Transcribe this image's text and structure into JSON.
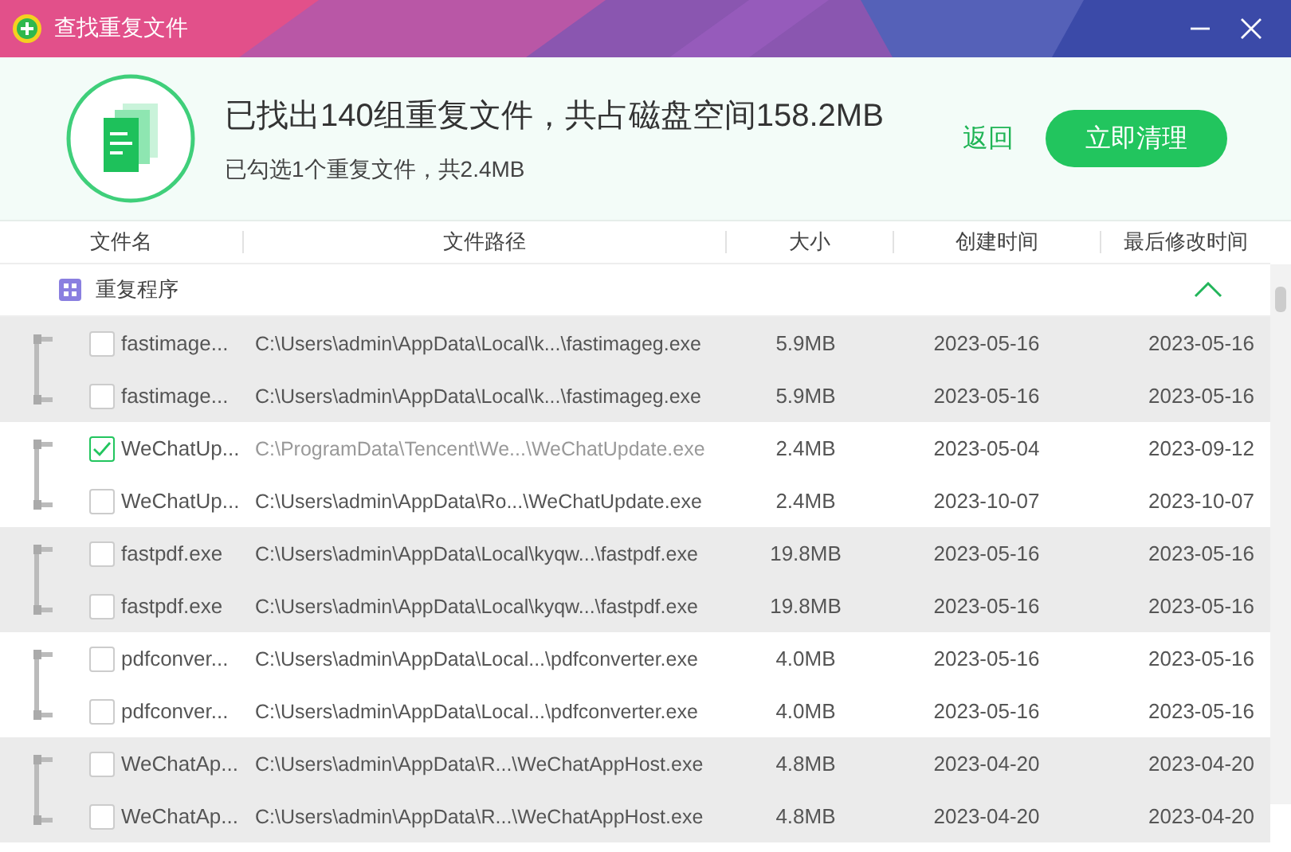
{
  "window": {
    "title": "查找重复文件"
  },
  "summary": {
    "headline": "已找出140组重复文件，共占磁盘空间158.2MB",
    "selection": "已勾选1个重复文件，共2.4MB",
    "back_link": "返回",
    "clean_button": "立即清理"
  },
  "table": {
    "columns": [
      "文件名",
      "文件路径",
      "大小",
      "创建时间",
      "最后修改时间"
    ],
    "category": {
      "label": "重复程序",
      "expanded": true
    },
    "groups": [
      {
        "rows": [
          {
            "name": "fastimage...",
            "path": "C:\\Users\\admin\\AppData\\Local\\k...\\fastimageg.exe",
            "size": "5.9MB",
            "created": "2023-05-16",
            "modified": "2023-05-16",
            "checked": false
          },
          {
            "name": "fastimage...",
            "path": "C:\\Users\\admin\\AppData\\Local\\k...\\fastimageg.exe",
            "size": "5.9MB",
            "created": "2023-05-16",
            "modified": "2023-05-16",
            "checked": false
          }
        ]
      },
      {
        "rows": [
          {
            "name": "WeChatUp...",
            "path": "C:\\ProgramData\\Tencent\\We...\\WeChatUpdate.exe",
            "size": "2.4MB",
            "created": "2023-05-04",
            "modified": "2023-09-12",
            "checked": true
          },
          {
            "name": "WeChatUp...",
            "path": "C:\\Users\\admin\\AppData\\Ro...\\WeChatUpdate.exe",
            "size": "2.4MB",
            "created": "2023-10-07",
            "modified": "2023-10-07",
            "checked": false
          }
        ]
      },
      {
        "rows": [
          {
            "name": "fastpdf.exe",
            "path": "C:\\Users\\admin\\AppData\\Local\\kyqw...\\fastpdf.exe",
            "size": "19.8MB",
            "created": "2023-05-16",
            "modified": "2023-05-16",
            "checked": false
          },
          {
            "name": "fastpdf.exe",
            "path": "C:\\Users\\admin\\AppData\\Local\\kyqw...\\fastpdf.exe",
            "size": "19.8MB",
            "created": "2023-05-16",
            "modified": "2023-05-16",
            "checked": false
          }
        ]
      },
      {
        "rows": [
          {
            "name": "pdfconver...",
            "path": "C:\\Users\\admin\\AppData\\Local...\\pdfconverter.exe",
            "size": "4.0MB",
            "created": "2023-05-16",
            "modified": "2023-05-16",
            "checked": false
          },
          {
            "name": "pdfconver...",
            "path": "C:\\Users\\admin\\AppData\\Local...\\pdfconverter.exe",
            "size": "4.0MB",
            "created": "2023-05-16",
            "modified": "2023-05-16",
            "checked": false
          }
        ]
      },
      {
        "rows": [
          {
            "name": "WeChatAp...",
            "path": "C:\\Users\\admin\\AppData\\R...\\WeChatAppHost.exe",
            "size": "4.8MB",
            "created": "2023-04-20",
            "modified": "2023-04-20",
            "checked": false
          },
          {
            "name": "WeChatAp...",
            "path": "C:\\Users\\admin\\AppData\\R...\\WeChatAppHost.exe",
            "size": "4.8MB",
            "created": "2023-04-20",
            "modified": "2023-04-20",
            "checked": false
          }
        ]
      }
    ]
  }
}
